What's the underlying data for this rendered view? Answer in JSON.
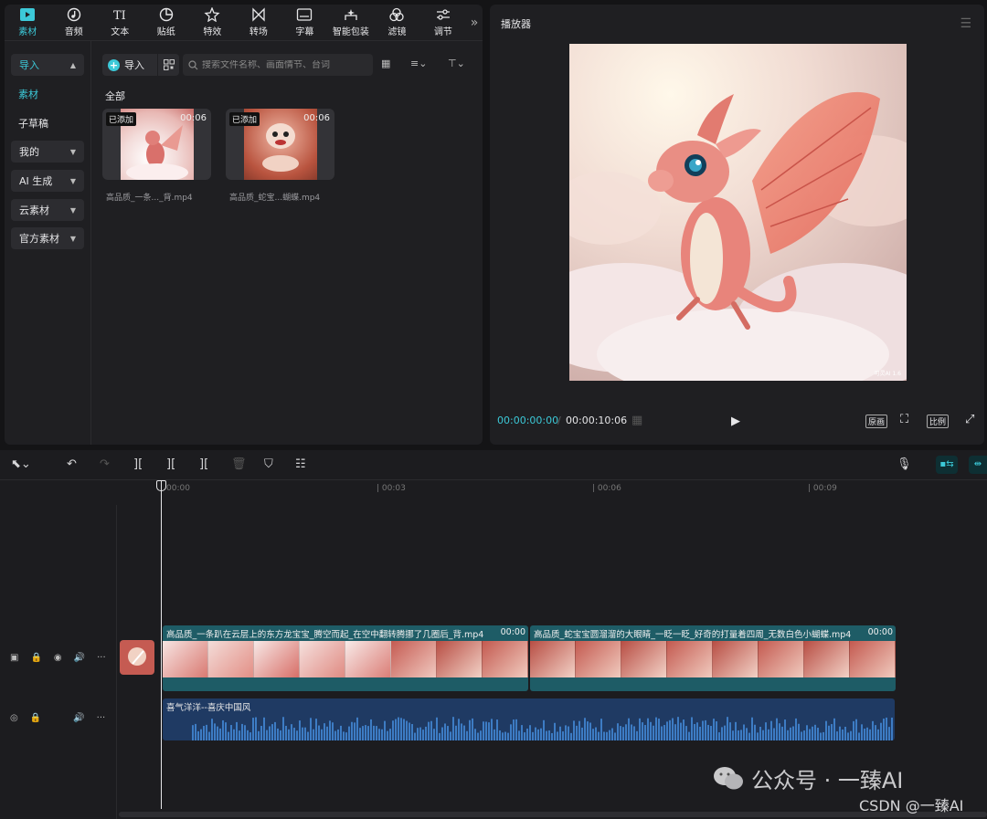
{
  "toolbar": {
    "tabs": [
      {
        "label": "素材",
        "icon": "media-icon",
        "active": true
      },
      {
        "label": "音频",
        "icon": "audio-icon"
      },
      {
        "label": "文本",
        "icon": "text-icon"
      },
      {
        "label": "贴纸",
        "icon": "sticker-icon"
      },
      {
        "label": "特效",
        "icon": "effects-icon"
      },
      {
        "label": "转场",
        "icon": "transition-icon"
      },
      {
        "label": "字幕",
        "icon": "subtitle-icon"
      },
      {
        "label": "智能包装",
        "icon": "smart-pack-icon"
      },
      {
        "label": "滤镜",
        "icon": "filter-icon"
      },
      {
        "label": "调节",
        "icon": "adjust-icon"
      }
    ],
    "more": "»"
  },
  "leftnav": {
    "import": "导入",
    "material": "素材",
    "sub_draft": "子草稿",
    "mine": "我的",
    "ai_gen": "AI 生成",
    "cloud": "云素材",
    "official": "官方素材"
  },
  "media": {
    "import_label": "导入",
    "search_placeholder": "搜索文件名称、画面情节、台词",
    "section": "全部",
    "items": [
      {
        "badge": "已添加",
        "duration": "00:06",
        "name": "高品质_一条..._背.mp4"
      },
      {
        "badge": "已添加",
        "duration": "00:06",
        "name": "高品质_蛇宝...蝴蝶.mp4"
      }
    ]
  },
  "player": {
    "title": "播放器",
    "time_current": "00:00:00:00",
    "time_sep": "/",
    "time_total": "00:00:10:06",
    "original_label": "原画",
    "ratio_label": "比例",
    "preview_watermark": "可灵AI 1.6"
  },
  "timeline": {
    "ruler": [
      "00:00",
      "| 00:03",
      "| 00:06",
      "| 00:09"
    ],
    "video_clips": [
      {
        "label": "高品质_一条趴在云层上的东方龙宝宝_腾空而起_在空中翻转腾挪了几圈后_背.mp4",
        "duration": "00:00"
      },
      {
        "label": "高品质_蛇宝宝圆溜溜的大眼睛_一眨一眨_好奇的打量着四周_无数白色小蝴蝶.mp4",
        "duration": "00:00"
      }
    ],
    "audio_clip": {
      "label": "喜气洋洋--喜庆中国风"
    }
  },
  "watermarks": {
    "wechat": "公众号 · 一臻AI",
    "csdn": "CSDN @一臻AI"
  },
  "colors": {
    "accent": "#3cc9d8",
    "video_clip": "#1e5c66",
    "audio_clip": "#1f3a63"
  }
}
